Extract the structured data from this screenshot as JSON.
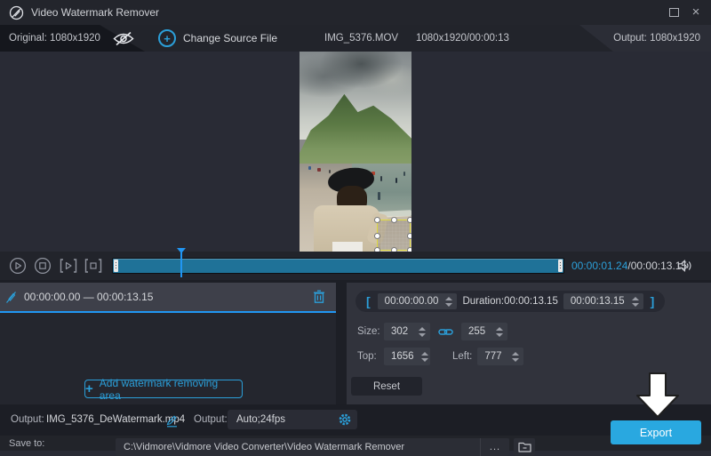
{
  "colors": {
    "accent": "#2b9fd9",
    "timeline_fill": "#1f7298",
    "export_bg": "#29a8e0",
    "selection_border": "#ddd83e",
    "panel_dark": "#24262e",
    "panel_light": "#31333c"
  },
  "titlebar": {
    "title": "Video Watermark Remover",
    "close_glyph": "×"
  },
  "infobar": {
    "original_label": "Original: 1080x1920",
    "change_source_plus": "+",
    "change_source_label": "Change Source File",
    "filename": "IMG_5376.MOV",
    "file_info": "1080x1920/00:00:13",
    "output_label": "Output: 1080x1920"
  },
  "transport": {
    "current_time": "00:00:01.24",
    "total_time": "/00:00:13.15"
  },
  "segment_panel": {
    "range": "00:00:00.00 — 00:00:13.15",
    "add_plus": "+",
    "add_area_label": "Add watermark removing area"
  },
  "properties_panel": {
    "bracket_open": "[",
    "bracket_close": "]",
    "start_time": "00:00:00.00",
    "duration_label": "Duration:00:00:13.15",
    "end_time": "00:00:13.15",
    "size_label": "Size:",
    "size_width": "302",
    "size_height": "255",
    "top_label": "Top:",
    "top_value": "1656",
    "left_label": "Left:",
    "left_value": "777",
    "reset_label": "Reset"
  },
  "output_bar": {
    "output_label": "Output:",
    "output_filename": "IMG_5376_DeWatermark.mp4",
    "format_label": "Output:",
    "format_value": "Auto;24fps",
    "export_label": "Export"
  },
  "save_bar": {
    "save_to_label": "Save to:",
    "path": "C:\\Vidmore\\Vidmore Video Converter\\Video Watermark Remover",
    "more_label": "..."
  },
  "icons": {
    "app_logo": "brush-slash-circle",
    "eye": "eye-slash",
    "trash": "trash-can",
    "link": "chain-link",
    "pencil": "edit-pencil",
    "gear": "settings-gear",
    "speaker": "volume-speaker",
    "folder": "open-folder",
    "annotation": "down-block-arrow"
  }
}
